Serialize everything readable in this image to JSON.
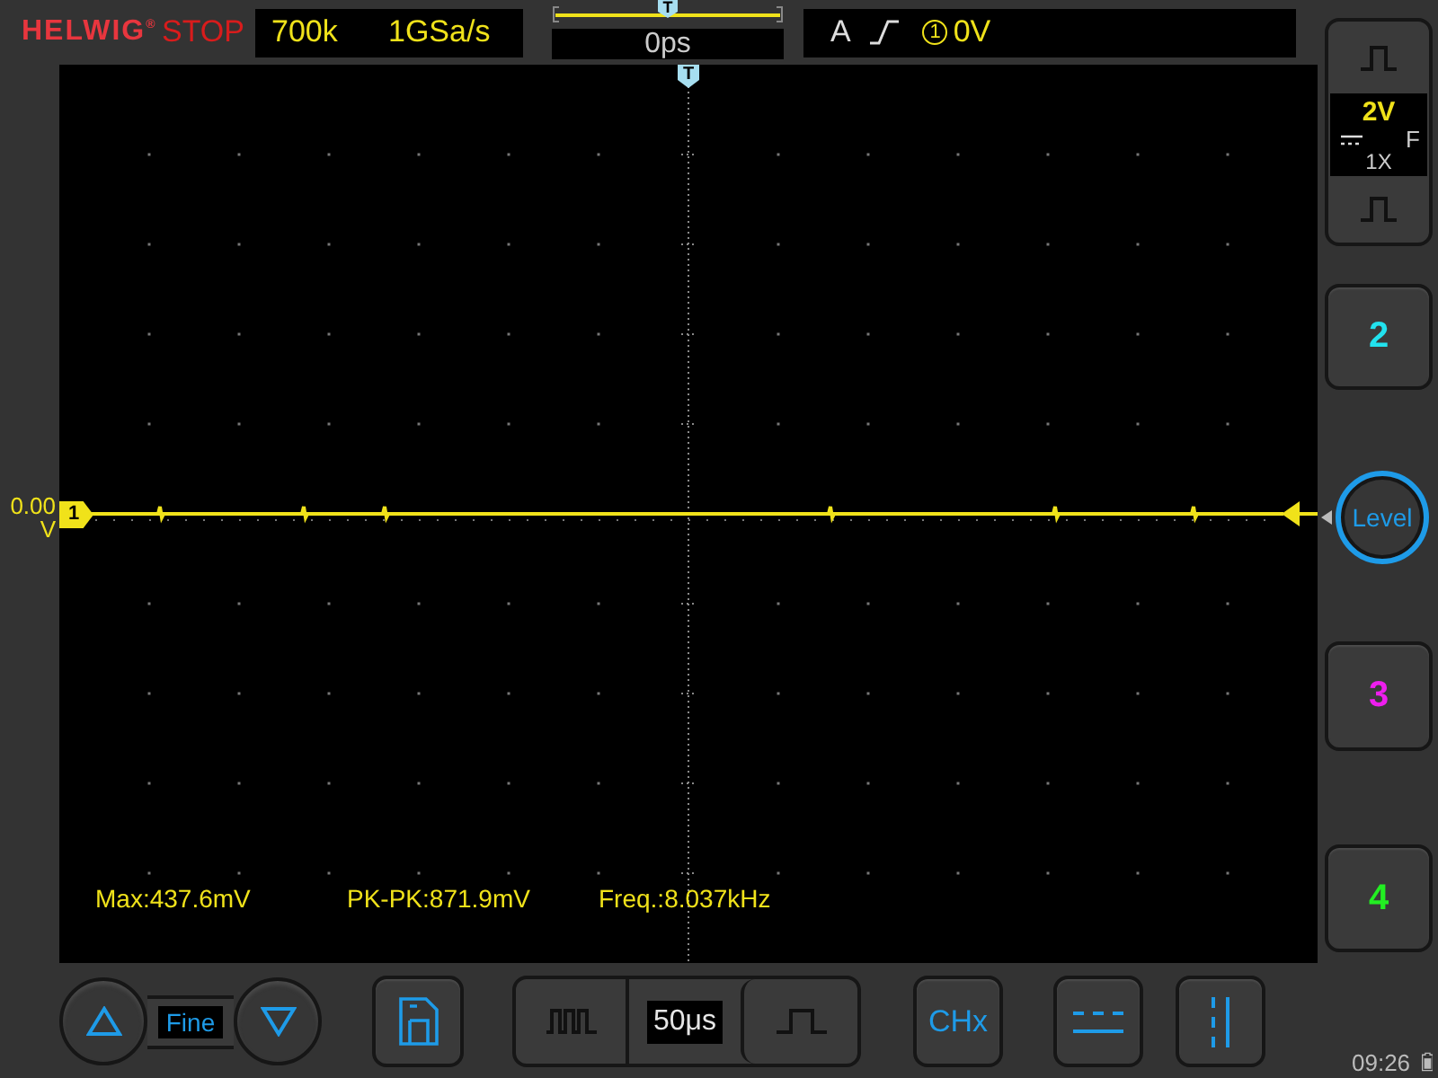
{
  "header": {
    "logo": "HELWIG$^{®}$",
    "run_state": "STOP",
    "memory_depth": "700k",
    "sample_rate": "1GSa/s",
    "timebase": {
      "position_marker": "T",
      "offset": "0ps"
    },
    "trigger": {
      "mode": "A",
      "source": "1",
      "level": "0V"
    }
  },
  "screen": {
    "trigger_position_marker": "T",
    "channel_marker": "1",
    "offset_value": "0.00",
    "offset_unit": "V",
    "measurements": [
      "Max:437.6mV",
      "PK-PK:871.9mV",
      "Freq.:8.037kHz"
    ]
  },
  "channel_1": {
    "scale": "2V",
    "bandwidth": "F",
    "probe": "1X"
  },
  "level_knob": "Level",
  "channels": [
    {
      "label": "2",
      "color": "#22e2ee"
    },
    {
      "label": "3",
      "color": "#ee1eee"
    },
    {
      "label": "4",
      "color": "#22ee22"
    }
  ],
  "bottom_bar": {
    "fine": "Fine",
    "timebase": "50μs",
    "channel_select": "CHx"
  },
  "status": {
    "time": "09:26"
  }
}
